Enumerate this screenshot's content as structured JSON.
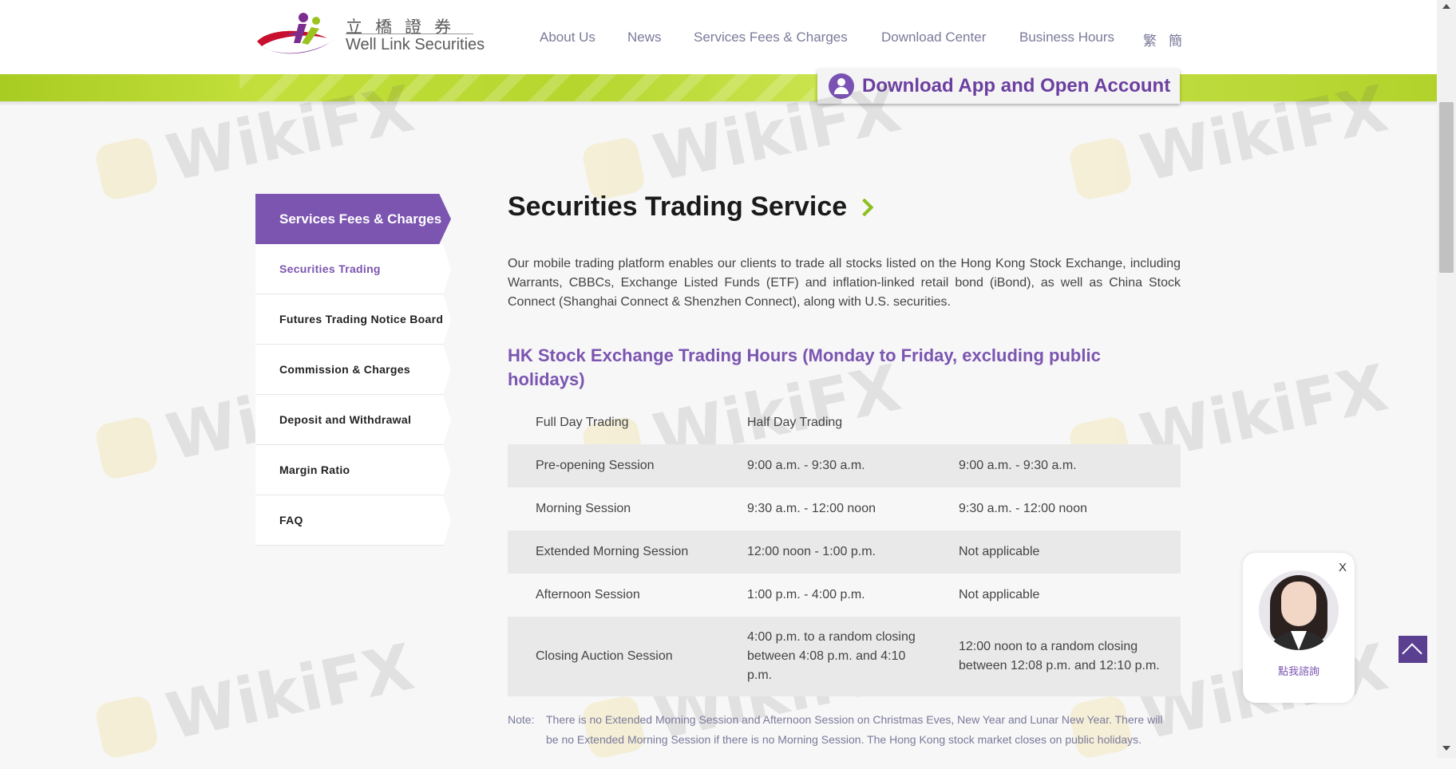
{
  "header": {
    "logo": {
      "chinese": "立橋證券",
      "english": "Well Link Securities"
    },
    "nav": [
      {
        "label": "About Us"
      },
      {
        "label": "News"
      },
      {
        "label": "Services Fees & Charges"
      },
      {
        "label": "Download Center"
      },
      {
        "label": "Business Hours"
      },
      {
        "label": "繁"
      },
      {
        "label": "簡"
      }
    ]
  },
  "banner": {
    "download_label": "Download App and Open Account",
    "icon": "user-icon"
  },
  "watermark": {
    "text": "WikiFX"
  },
  "sidebar": {
    "heading": "Services Fees & Charges",
    "items": [
      {
        "label": "Securities Trading",
        "active": true
      },
      {
        "label": "Futures Trading Notice Board",
        "active": false
      },
      {
        "label": "Commission & Charges",
        "active": false
      },
      {
        "label": "Deposit and Withdrawal",
        "active": false
      },
      {
        "label": "Margin Ratio",
        "active": false
      },
      {
        "label": "FAQ",
        "active": false
      }
    ]
  },
  "main": {
    "title": "Securities Trading Service",
    "intro": "Our mobile trading platform enables our clients to trade all stocks listed on the Hong Kong Stock Exchange, including Warrants, CBBCs, Exchange Listed Funds (ETF) and inflation-linked retail bond (iBond), as well as China Stock Connect (Shanghai Connect & Shenzhen Connect), along with U.S. securities.",
    "subheading": "HK Stock Exchange Trading Hours (Monday to Friday, excluding public holidays)",
    "table": {
      "headers": [
        "",
        "Full Day Trading",
        "Half Day Trading"
      ],
      "rows": [
        {
          "session": "Pre-opening Session",
          "full": "9:00 a.m. - 9:30 a.m.",
          "half": "9:00 a.m. - 9:30 a.m."
        },
        {
          "session": "Morning Session",
          "full": "9:30 a.m. - 12:00 noon",
          "half": "9:30 a.m. - 12:00 noon"
        },
        {
          "session": "Extended Morning Session",
          "full": "12:00 noon - 1:00 p.m.",
          "half": "Not applicable"
        },
        {
          "session": "Afternoon Session",
          "full": "1:00 p.m. - 4:00 p.m.",
          "half": "Not applicable"
        },
        {
          "session": "Closing Auction Session",
          "full": "4:00 p.m. to a random closing between 4:08 p.m. and 4:10 p.m.",
          "half": "12:00 noon to a random closing between 12:08 p.m. and 12:10 p.m."
        }
      ]
    },
    "note": {
      "label": "Note:",
      "text": "There is no Extended Morning Session and Afternoon Session on Christmas Eves, New Year and Lunar New Year. There will be no Extended Morning Session if there is no Morning Session. The Hong Kong stock market closes on public holidays."
    }
  },
  "chat": {
    "close_label": "X",
    "label": "點我諮詢"
  },
  "colors": {
    "brand_purple": "#7b55b0",
    "accent_green": "#a8cc22",
    "title_chevron": "#8cbf1e"
  }
}
